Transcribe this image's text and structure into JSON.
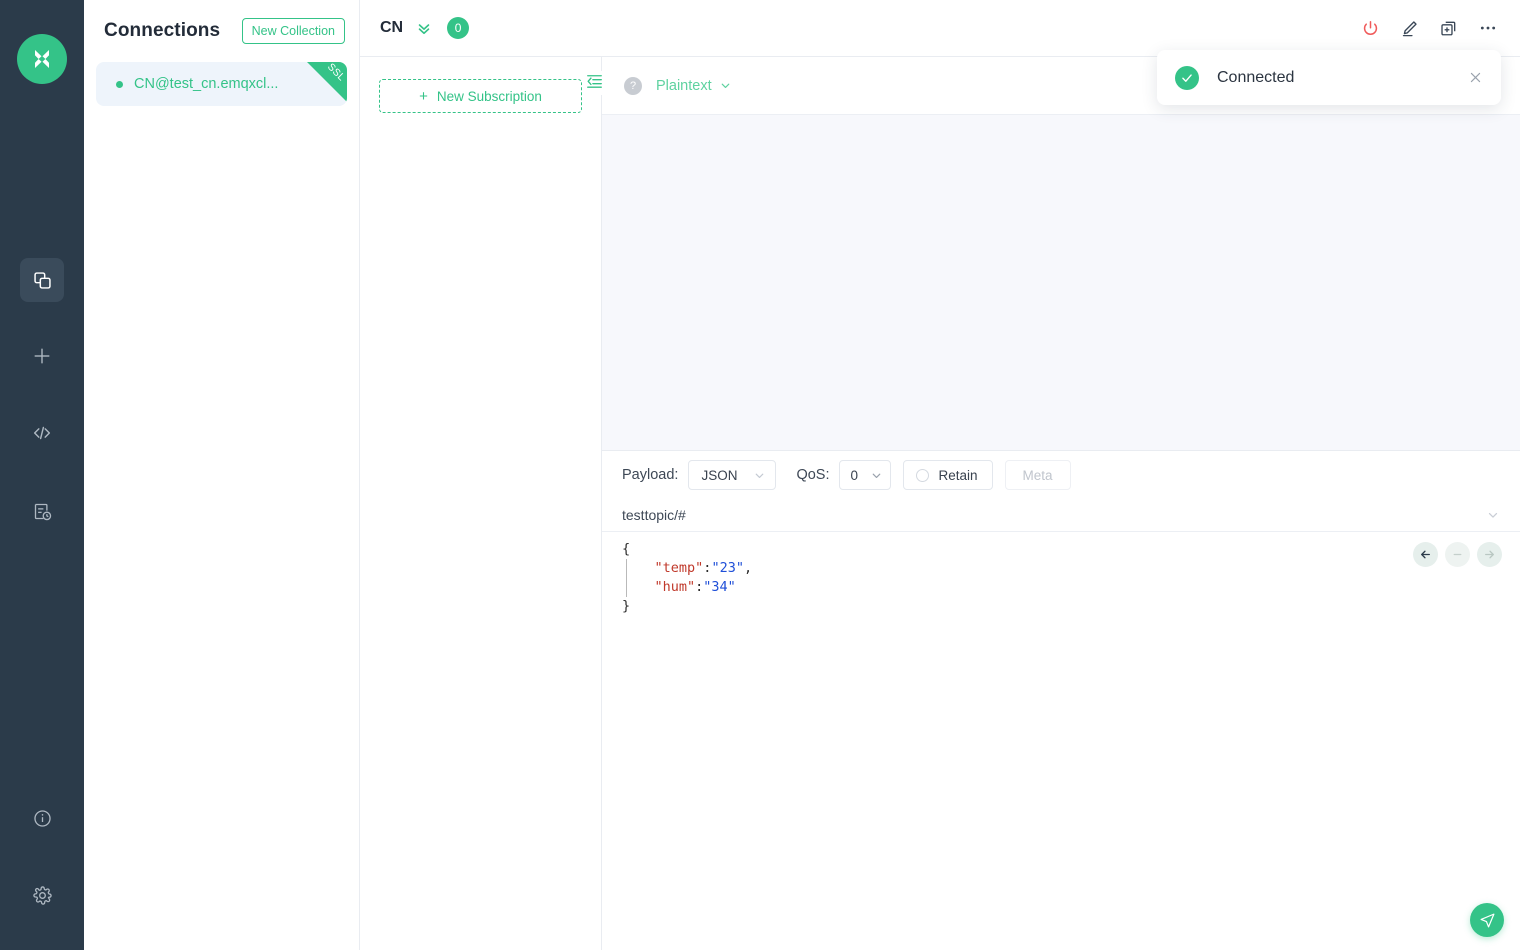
{
  "rail": {
    "logo": "emqx-logo-icon",
    "items": [
      {
        "name": "connections-icon",
        "label": "Connections",
        "active": true
      },
      {
        "name": "new-connection-icon",
        "label": "New Connection",
        "active": false
      },
      {
        "name": "code-icon",
        "label": "Scripts",
        "active": false
      },
      {
        "name": "log-history-icon",
        "label": "Log",
        "active": false
      },
      {
        "name": "info-icon",
        "label": "About",
        "active": false
      },
      {
        "name": "gear-icon",
        "label": "Settings",
        "active": false
      }
    ]
  },
  "connections": {
    "title": "Connections",
    "new_collection_label": "New Collection",
    "items": [
      {
        "name": "CN@test_cn.emqxcl...",
        "status": "connected",
        "badge": "SSL"
      }
    ]
  },
  "topbar": {
    "connection_name": "CN",
    "collapse_icon": "chevron-double-down-icon",
    "message_count": "0",
    "actions": [
      {
        "name": "disconnect-power-icon",
        "label": "Disconnect"
      },
      {
        "name": "edit-pencil-icon",
        "label": "Edit"
      },
      {
        "name": "duplicate-add-icon",
        "label": "New Window"
      },
      {
        "name": "more-options-icon",
        "label": "More"
      }
    ]
  },
  "subscriptions": {
    "new_subscription_label": "New Subscription",
    "plus_icon": "plus-icon",
    "items": []
  },
  "conversation": {
    "collapse_icon": "collapse-panel-icon",
    "help_icon": "question-mark-icon",
    "format_label": "Plaintext",
    "format_chevron": "chevron-down-icon",
    "messages": []
  },
  "publish": {
    "payload_label": "Payload:",
    "payload_format": "JSON",
    "qos_label": "QoS:",
    "qos_value": "0",
    "retain_label": "Retain",
    "retain_checked": false,
    "meta_label": "Meta",
    "topic": "testtopic/#",
    "topic_chevron": "chevron-down-icon",
    "payload_lines": [
      {
        "indent": 0,
        "tokens": [
          {
            "t": "{",
            "c": "punc"
          }
        ]
      },
      {
        "indent": 1,
        "tokens": [
          {
            "t": "\"temp\"",
            "c": "key"
          },
          {
            "t": ":",
            "c": "punc"
          },
          {
            "t": "\"23\"",
            "c": "val"
          },
          {
            "t": ",",
            "c": "punc"
          }
        ]
      },
      {
        "indent": 1,
        "tokens": [
          {
            "t": "\"hum\"",
            "c": "key"
          },
          {
            "t": ":",
            "c": "punc"
          },
          {
            "t": "\"34\"",
            "c": "val"
          }
        ]
      },
      {
        "indent": 0,
        "tokens": [
          {
            "t": "}",
            "c": "punc"
          }
        ]
      }
    ],
    "nav_buttons": [
      {
        "name": "history-back-button",
        "icon": "arrow-left-icon",
        "state": "active"
      },
      {
        "name": "history-clear-button",
        "icon": "minus-icon",
        "state": "disabled"
      },
      {
        "name": "history-forward-button",
        "icon": "arrow-right-icon",
        "state": "disabled"
      }
    ],
    "send_icon": "send-paper-plane-icon"
  },
  "toast": {
    "message": "Connected",
    "status_icon": "check-circle-icon",
    "close_icon": "close-icon"
  },
  "colors": {
    "accent_green": "#34c388",
    "rail_bg": "#2b3b4a",
    "message_area_bg": "#f7f8fc",
    "selected_item_bg": "#eef4fb",
    "danger_red": "#f05a5a",
    "json_key": "#c0392b",
    "json_value": "#1f4fd8"
  }
}
